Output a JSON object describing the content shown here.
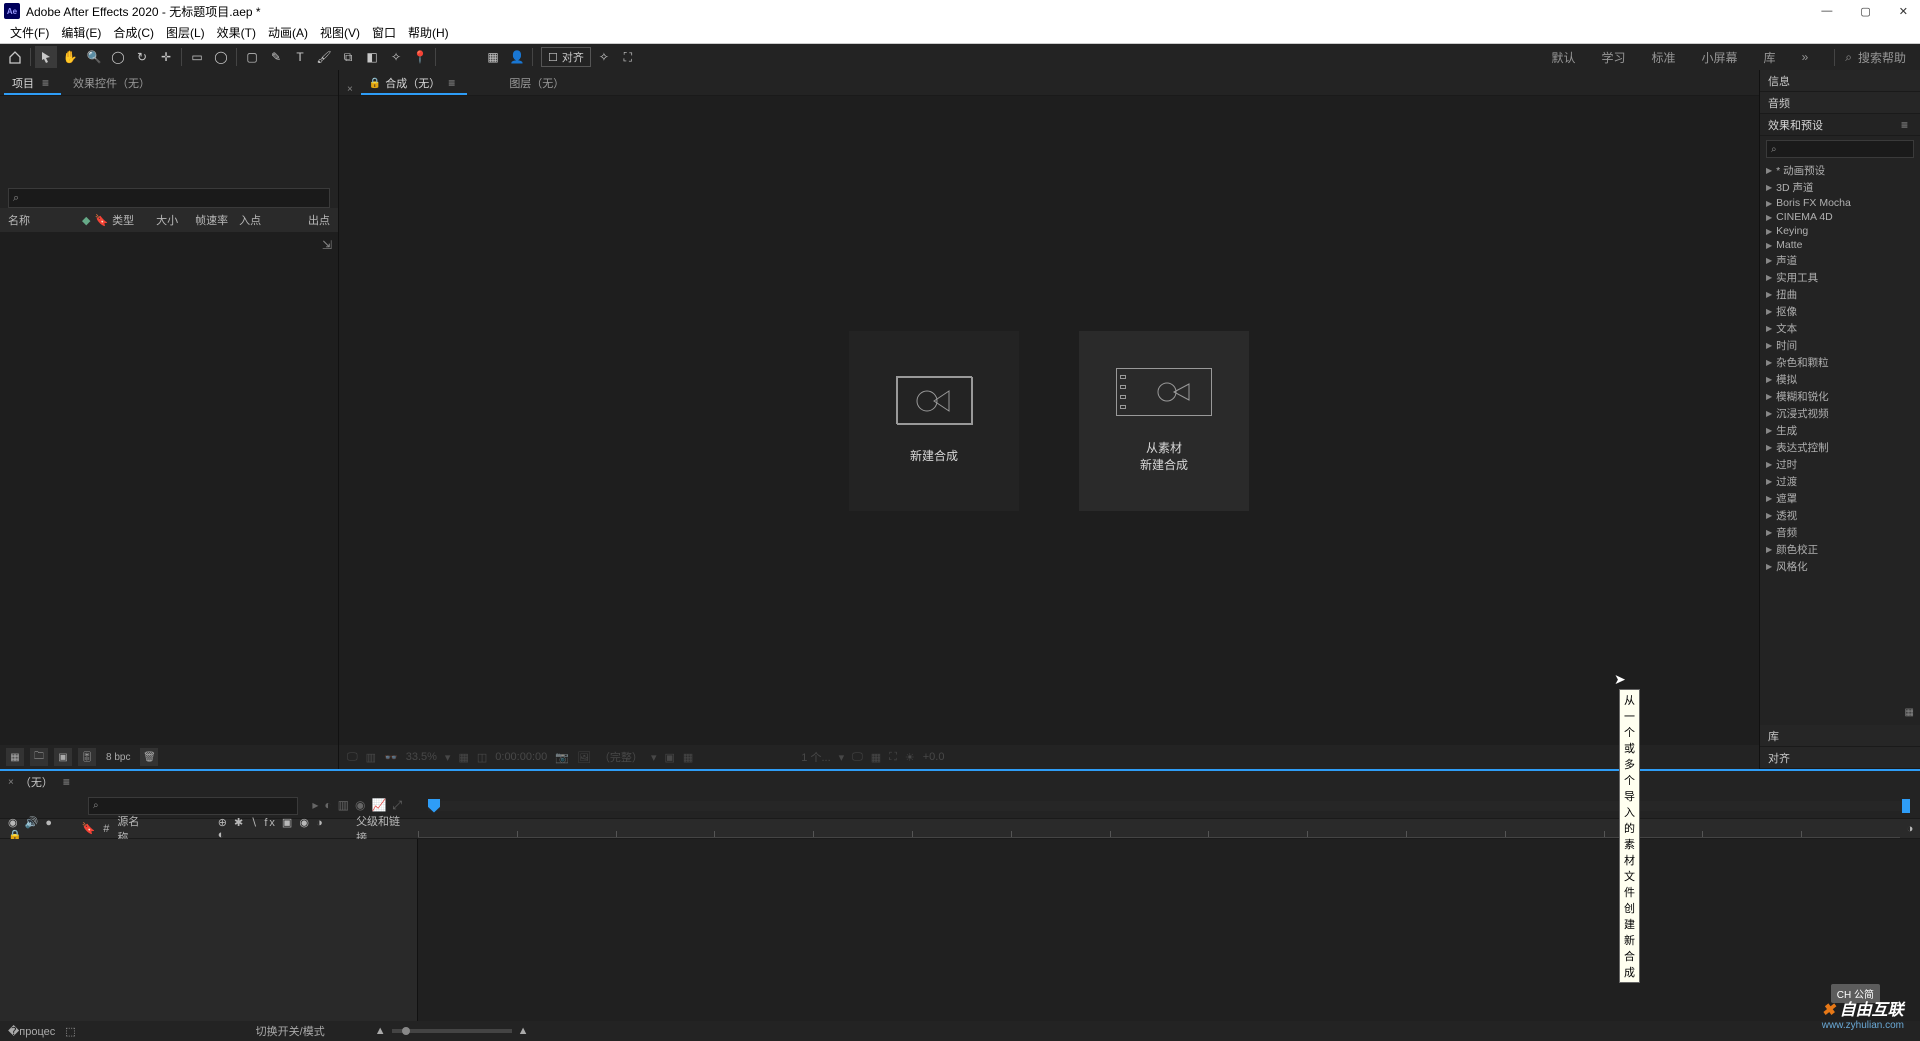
{
  "title": "Adobe After Effects 2020 - 无标题项目.aep *",
  "app_icon_text": "Ae",
  "window_controls": {
    "min": "—",
    "max": "▢",
    "close": "✕"
  },
  "menu": [
    "文件(F)",
    "编辑(E)",
    "合成(C)",
    "图层(L)",
    "效果(T)",
    "动画(A)",
    "视图(V)",
    "窗口",
    "帮助(H)"
  ],
  "toolbar": {
    "align_label": "对齐",
    "workspace_links": [
      "默认",
      "学习",
      "标准",
      "小屏幕",
      "库"
    ],
    "more": "»",
    "search_help_placeholder": "搜索帮助"
  },
  "project": {
    "tab_project": "项目",
    "tab_effect_controls": "效果控件（无）",
    "search_icon": "⌕",
    "columns": {
      "name": "名称",
      "type": "类型",
      "size": "大小",
      "fps": "帧速率",
      "in": "入点",
      "out": "出点"
    },
    "footer_bpc": "8 bpc"
  },
  "comp": {
    "tab_comp": "合成（无）",
    "tab_layer": "图层（无）",
    "card_new": "新建合成",
    "card_from_line1": "从素材",
    "card_from_line2": "新建合成",
    "tooltip": "从一个或多个导入的素材文件创建新合成",
    "footer": {
      "mag": "33.5%",
      "time": "0:00:00:00",
      "full": "（完整）",
      "one": "1 个...",
      "plus": "+0.0"
    }
  },
  "right": {
    "info": "信息",
    "audio": "音频",
    "effects_presets": "效果和预设",
    "ep_items": [
      "* 动画预设",
      "3D 声道",
      "Boris FX Mocha",
      "CINEMA 4D",
      "Keying",
      "Matte",
      "声道",
      "实用工具",
      "扭曲",
      "抠像",
      "文本",
      "时间",
      "杂色和颗粒",
      "模拟",
      "模糊和锐化",
      "沉浸式视频",
      "生成",
      "表达式控制",
      "过时",
      "过渡",
      "遮罩",
      "透视",
      "音频",
      "颜色校正",
      "风格化"
    ],
    "library": "库",
    "align": "对齐"
  },
  "timeline": {
    "tab_none": "（无）",
    "hdr_source_name": "源名称",
    "hdr_parent_link": "父级和链接",
    "footer_switch": "切换开关/模式"
  },
  "watermark": {
    "brand": "自由互联",
    "sub": "www.zyhulian.com"
  },
  "ime": "CH 公简"
}
